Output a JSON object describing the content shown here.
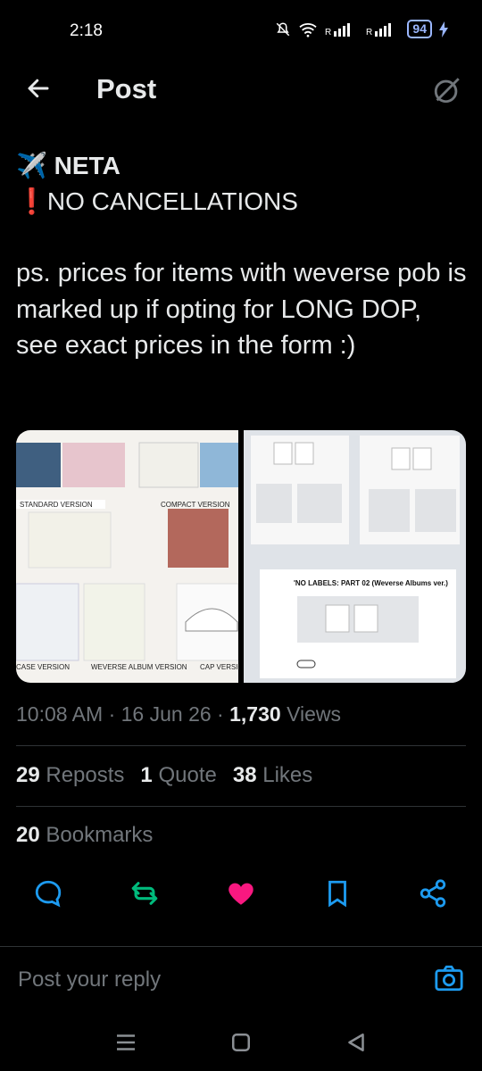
{
  "status": {
    "time": "2:18",
    "battery": "94"
  },
  "header": {
    "title": "Post"
  },
  "post": {
    "line1": "✈️ NETA",
    "line2": "❗NO CANCELLATIONS",
    "para": "ps. prices for items with weverse pob is marked up if opting for LONG DOP, see exact prices in the form :)",
    "images": {
      "left_labels": [
        "STANDARD VERSION",
        "COMPACT VERSION",
        "CASE VERSION",
        "WEVERSE ALBUM VERSION",
        "CAP VERSION",
        "NO LABELS",
        "PART 02"
      ],
      "right_title": "'NO LABELS: PART 02 (Weverse Albums ver.)"
    }
  },
  "meta": {
    "time": "10:08 AM",
    "date": "16 Jun 26",
    "views": "1,730",
    "views_label": "Views"
  },
  "stats": {
    "reposts": "29",
    "reposts_label": "Reposts",
    "quotes": "1",
    "quotes_label": "Quote",
    "likes": "38",
    "likes_label": "Likes"
  },
  "bookmarks": {
    "count": "20",
    "label": "Bookmarks"
  },
  "reply": {
    "placeholder": "Post your reply"
  },
  "colors": {
    "accent": "#1d9bf0",
    "like": "#f91880",
    "repost": "#00ba7c",
    "muted": "#71767b"
  }
}
